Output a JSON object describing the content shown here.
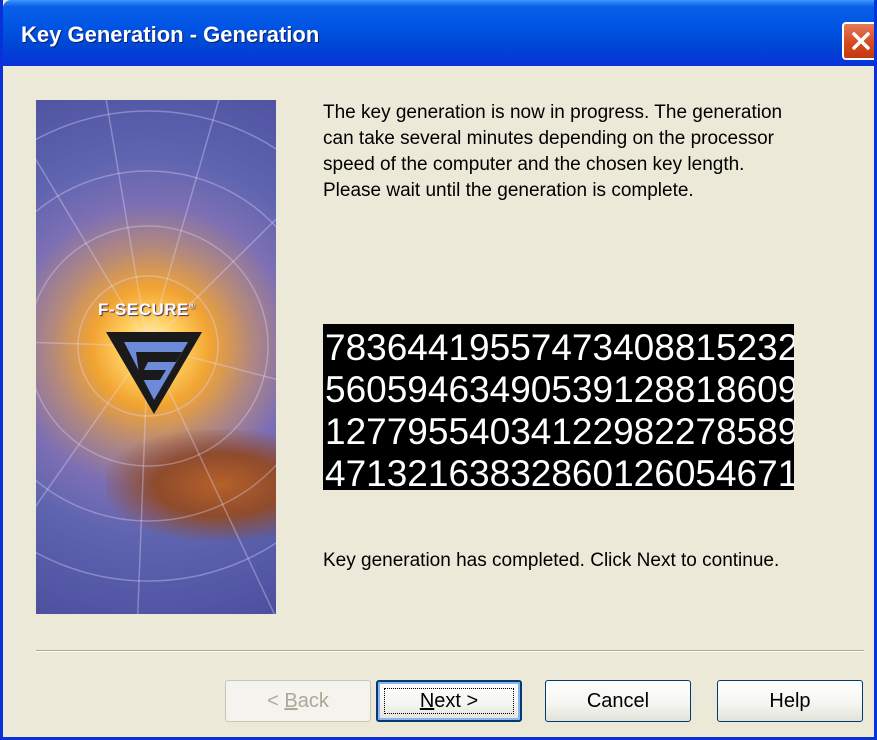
{
  "window": {
    "title": "Key Generation - Generation"
  },
  "titlebar": {
    "close_icon": "close-icon"
  },
  "side_image": {
    "logo_text": "F-SECURE",
    "logo_mark": "®",
    "logo_icon": "f-secure-logo-icon"
  },
  "description": "The key generation is now in progress. The generation can take several minutes depending on the processor speed of the computer and the chosen key length. Please wait until the generation is complete.",
  "key_display": {
    "lines": [
      "78364419557473408815232",
      "56059463490539128818609",
      "12779554034122982278589",
      "47132163832860126054671"
    ]
  },
  "status": "Key generation has completed. Click Next to continue.",
  "buttons": {
    "back": {
      "prefix": "< ",
      "mnemonic": "B",
      "rest": "ack",
      "enabled": false
    },
    "next": {
      "mnemonic": "N",
      "rest": "ext >",
      "enabled": true
    },
    "cancel": {
      "label": "Cancel",
      "enabled": true
    },
    "help": {
      "label": "Help",
      "enabled": true
    }
  },
  "colors": {
    "titlebar": "#0054e3",
    "dialog_bg": "#ece9d8",
    "close_button": "#d64a20",
    "key_bg": "#000000",
    "key_text": "#ffffff"
  }
}
